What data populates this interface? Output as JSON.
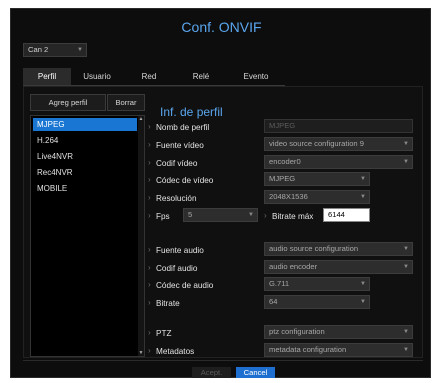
{
  "window": {
    "title": "Conf. ONVIF"
  },
  "channel": {
    "value": "Can 2"
  },
  "tabs": [
    {
      "label": "Perfil"
    },
    {
      "label": "Usuario"
    },
    {
      "label": "Red"
    },
    {
      "label": "Relé"
    },
    {
      "label": "Evento"
    }
  ],
  "profile_buttons": {
    "add": "Agreg perfil",
    "delete": "Borrar"
  },
  "profiles": [
    "MJPEG",
    "H.264",
    "Live4NVR",
    "Rec4NVR",
    "MOBILE"
  ],
  "section_title": "Inf. de perfil",
  "form": {
    "profile_name": {
      "label": "Nomb de perfil",
      "value": "MJPEG"
    },
    "video_source": {
      "label": "Fuente vídeo",
      "value": "video source configuration 9"
    },
    "video_encoder": {
      "label": "Codif vídeo",
      "value": "encoder0"
    },
    "video_codec": {
      "label": "Códec de vídeo",
      "value": "MJPEG"
    },
    "resolution": {
      "label": "Resolución",
      "value": "2048X1536"
    },
    "fps": {
      "label": "Fps",
      "value": "5"
    },
    "max_bitrate": {
      "label": "Bitrate máx",
      "value": "6144"
    },
    "audio_source": {
      "label": "Fuente audio",
      "value": "audio source configuration"
    },
    "audio_encoder": {
      "label": "Codif audio",
      "value": "audio encoder"
    },
    "audio_codec": {
      "label": "Códec de audio",
      "value": "G.711"
    },
    "bitrate": {
      "label": "Bitrate",
      "value": "64"
    },
    "ptz": {
      "label": "PTZ",
      "value": "ptz configuration"
    },
    "metadata": {
      "label": "Metadatos",
      "value": "metadata configuration"
    }
  },
  "footer": {
    "apply": "Acept.",
    "cancel": "Cancel"
  },
  "colors": {
    "accent": "#5aa6ef",
    "selected": "#1976d2",
    "background": "#0d0d0d"
  }
}
